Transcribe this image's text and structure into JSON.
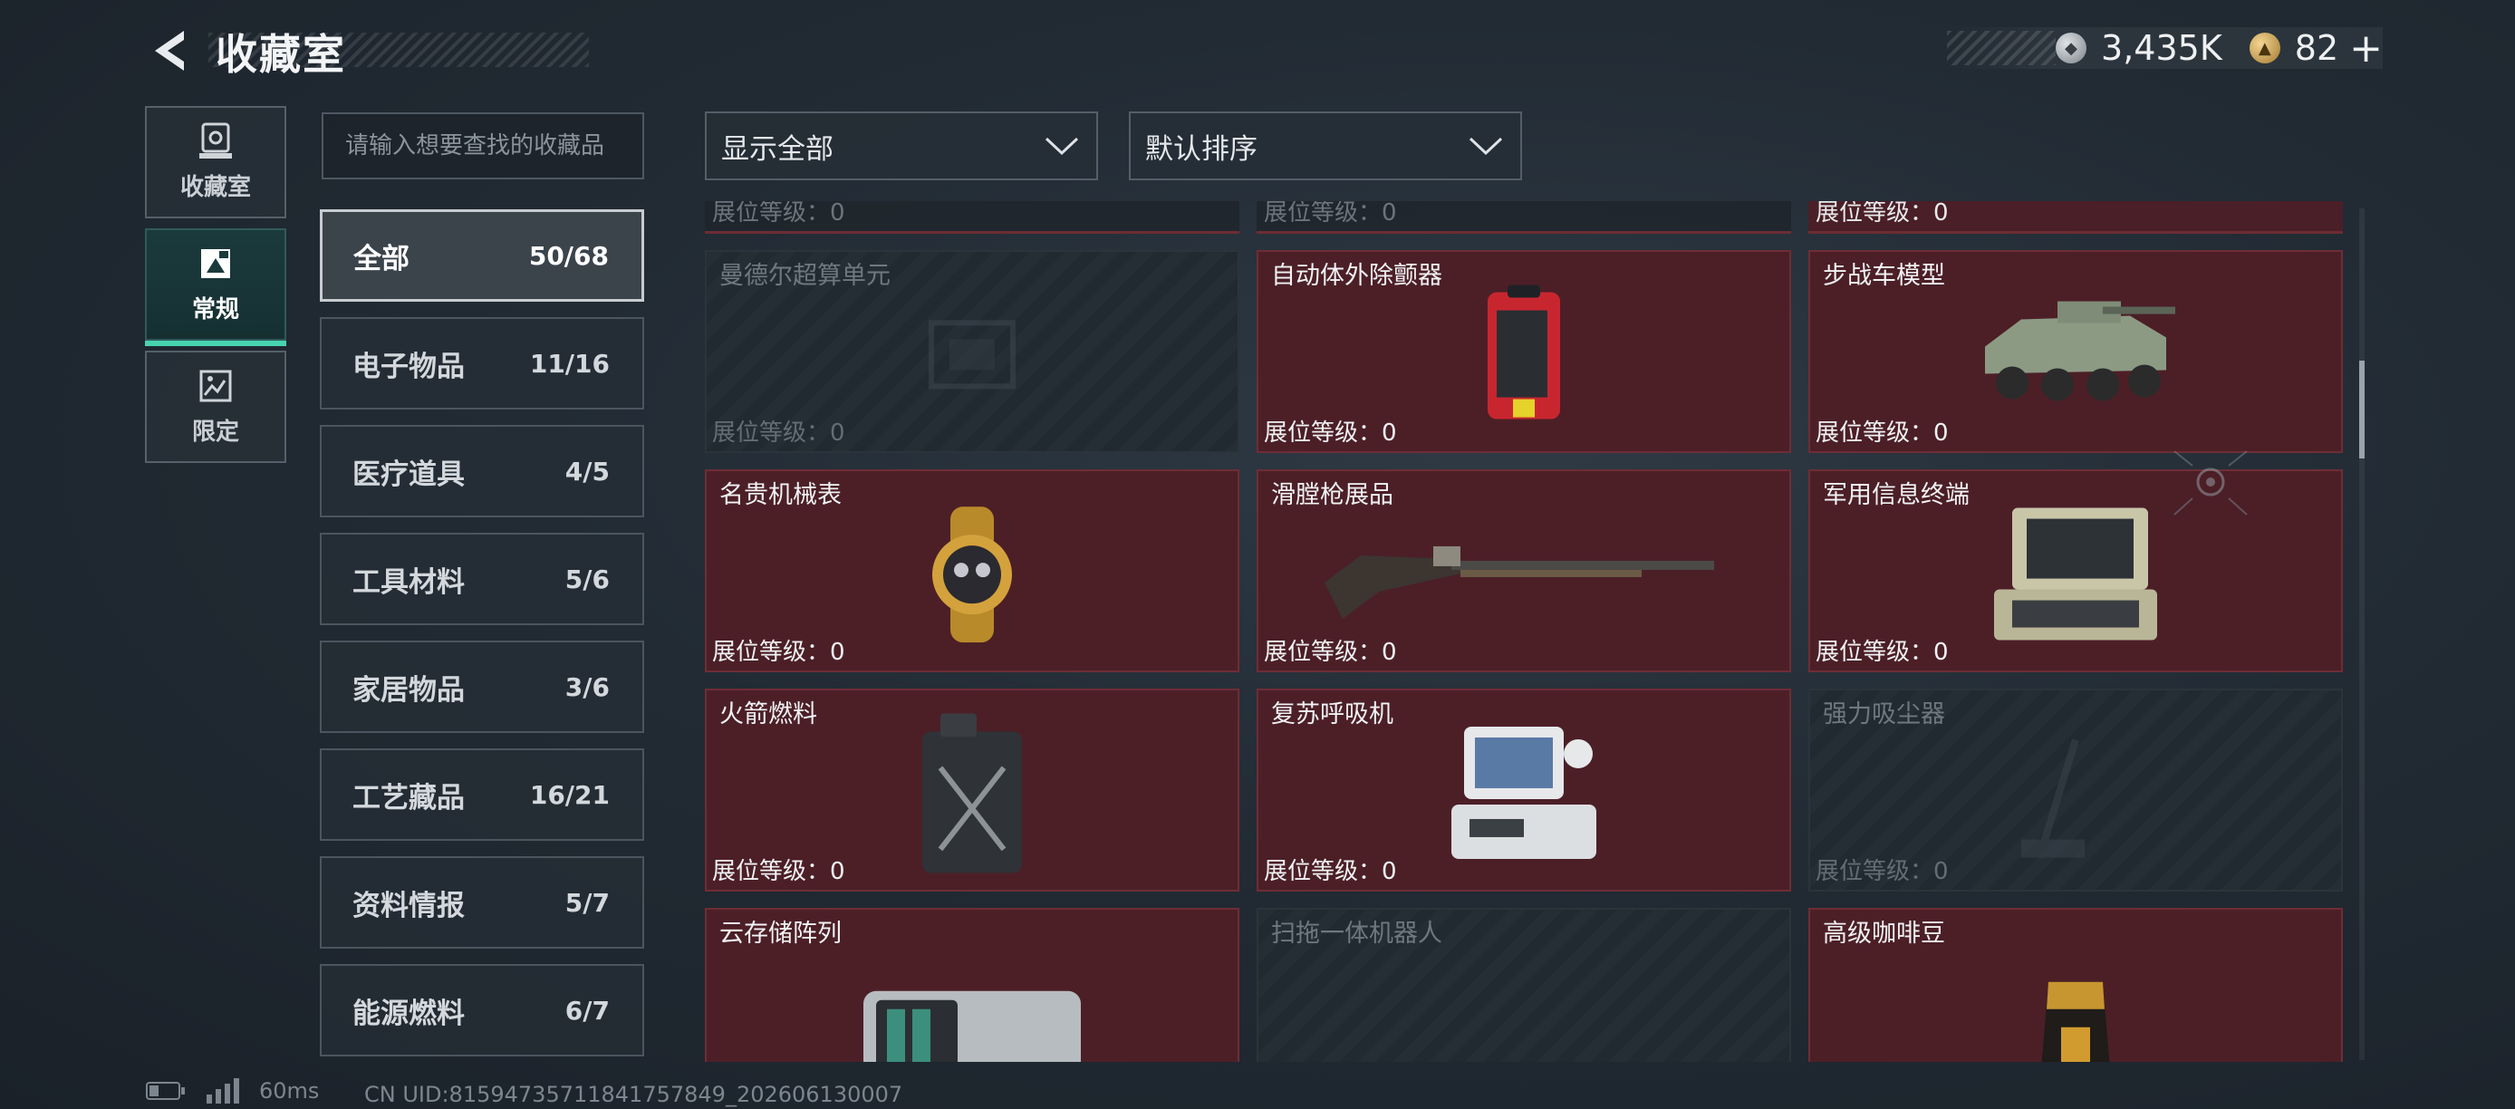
{
  "header": {
    "title": "收藏室",
    "currency": [
      {
        "icon": "silver-coin-icon",
        "value": "3,435K"
      },
      {
        "icon": "gold-coin-icon",
        "value": "82"
      }
    ],
    "plus_label": "+"
  },
  "leftnav": [
    {
      "label": "收藏室",
      "icon": "showcase-icon",
      "active": false
    },
    {
      "label": "常规",
      "icon": "regular-collection-icon",
      "active": true
    },
    {
      "label": "限定",
      "icon": "limited-collection-icon",
      "active": false
    }
  ],
  "search": {
    "placeholder": "请输入想要查找的收藏品"
  },
  "categories": [
    {
      "label": "全部",
      "count": "50/68",
      "active": true
    },
    {
      "label": "电子物品",
      "count": "11/16"
    },
    {
      "label": "医疗道具",
      "count": "4/5"
    },
    {
      "label": "工具材料",
      "count": "5/6"
    },
    {
      "label": "家居物品",
      "count": "3/6"
    },
    {
      "label": "工艺藏品",
      "count": "16/21"
    },
    {
      "label": "资料情报",
      "count": "5/7"
    },
    {
      "label": "能源燃料",
      "count": "6/7"
    }
  ],
  "filters": {
    "display": "显示全部",
    "sort": "默认排序"
  },
  "top_partial_row": [
    {
      "level": "展位等级：0"
    },
    {
      "level": "展位等级：0"
    },
    {
      "level": "展位等级：0"
    }
  ],
  "items": [
    {
      "name": "曼德尔超算单元",
      "level": "展位等级：0",
      "owned": false
    },
    {
      "name": "自动体外除颤器",
      "level": "展位等级：0",
      "owned": true
    },
    {
      "name": "步战车模型",
      "level": "展位等级：0",
      "owned": true
    },
    {
      "name": "名贵机械表",
      "level": "展位等级：0",
      "owned": true
    },
    {
      "name": "滑膛枪展品",
      "level": "展位等级：0",
      "owned": true
    },
    {
      "name": "军用信息终端",
      "level": "展位等级：0",
      "owned": true
    },
    {
      "name": "火箭燃料",
      "level": "展位等级：0",
      "owned": true
    },
    {
      "name": "复苏呼吸机",
      "level": "展位等级：0",
      "owned": true
    },
    {
      "name": "强力吸尘器",
      "level": "展位等级：0",
      "owned": false
    },
    {
      "name": "云存储阵列",
      "level": "",
      "owned": true
    },
    {
      "name": "扫拖一体机器人",
      "level": "",
      "owned": false
    },
    {
      "name": "高级咖啡豆",
      "level": "",
      "owned": true
    }
  ],
  "footer": {
    "ping": "60ms",
    "uid": "CN UID:8159473571184175​7849_202606130007"
  },
  "colors": {
    "owned_bg": "#4c1f27",
    "accent": "#46d4b0"
  }
}
